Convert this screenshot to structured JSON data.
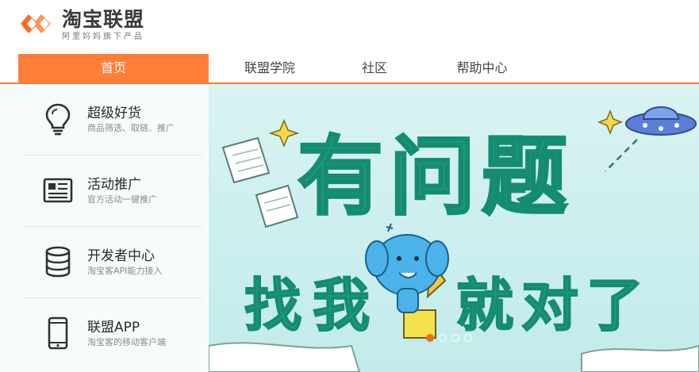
{
  "brand": {
    "title": "淘宝联盟",
    "subtitle": "阿里妈妈旗下产品",
    "accent": "#ff7f3a"
  },
  "nav": {
    "items": [
      {
        "label": "首页",
        "active": true
      },
      {
        "label": "联盟学院"
      },
      {
        "label": "社区"
      },
      {
        "label": "帮助中心"
      }
    ]
  },
  "side_menu": {
    "items": [
      {
        "title": "超级好货",
        "desc": "商品筛选、取链、推广",
        "icon": "lightbulb-icon"
      },
      {
        "title": "活动推广",
        "desc": "官方活动一键推广",
        "icon": "newspaper-icon"
      },
      {
        "title": "开发者中心",
        "desc": "淘宝客API能力接入",
        "icon": "database-icon"
      },
      {
        "title": "联盟APP",
        "desc": "淘宝客的移动客户端",
        "icon": "mobile-phone-icon"
      }
    ]
  },
  "banner": {
    "headline": "有问题",
    "slogan_a": "找我",
    "slogan_b": "就对了",
    "slide_count": 4,
    "active_slide": 1
  }
}
